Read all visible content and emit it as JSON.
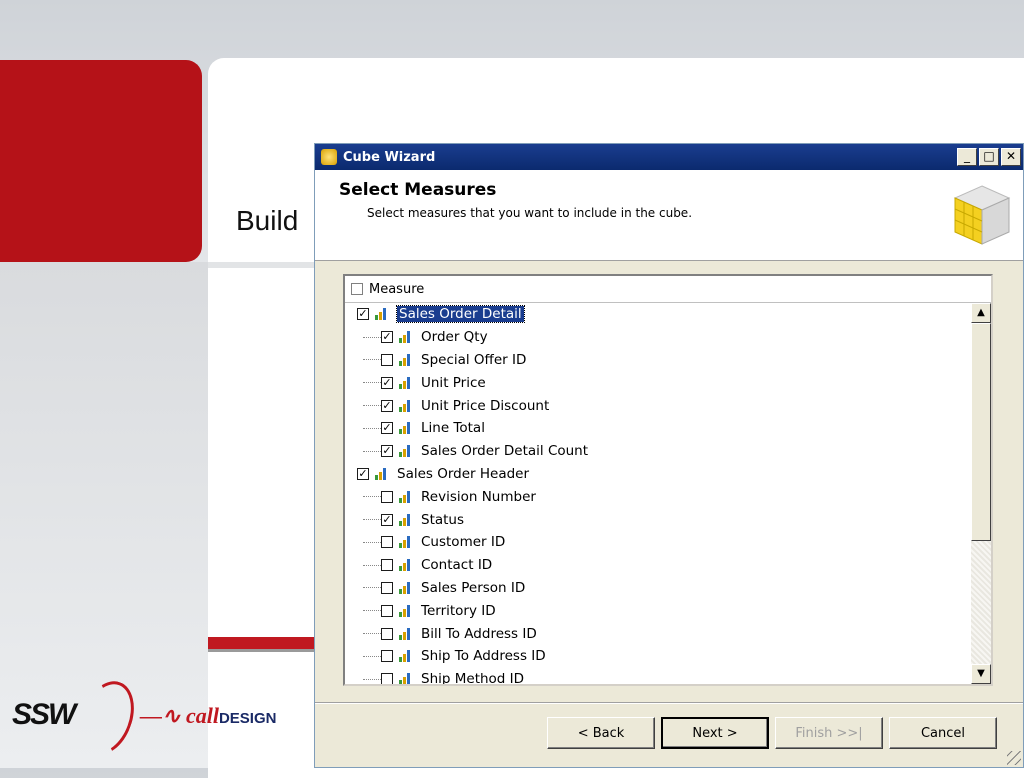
{
  "slide": {
    "title_fragment": "Build",
    "ssw_logo_text": "SSW",
    "call_logo_text": "call",
    "call_logo_design": "DESIGN"
  },
  "window": {
    "title": "Cube Wizard",
    "minimize_label": "_",
    "maximize_label": "□",
    "close_label": "✕"
  },
  "header": {
    "title": "Select Measures",
    "subtitle": "Select measures that you want to include in the cube."
  },
  "list": {
    "column_header": "Measure",
    "column_checked": false,
    "groups": [
      {
        "label": "Sales Order Detail",
        "checked": true,
        "selected": true,
        "items": [
          {
            "label": "Order Qty",
            "checked": true
          },
          {
            "label": "Special Offer ID",
            "checked": false
          },
          {
            "label": "Unit Price",
            "checked": true
          },
          {
            "label": "Unit Price Discount",
            "checked": true
          },
          {
            "label": "Line Total",
            "checked": true
          },
          {
            "label": "Sales Order Detail Count",
            "checked": true
          }
        ]
      },
      {
        "label": "Sales Order Header",
        "checked": true,
        "selected": false,
        "items": [
          {
            "label": "Revision Number",
            "checked": false
          },
          {
            "label": "Status",
            "checked": true
          },
          {
            "label": "Customer ID",
            "checked": false
          },
          {
            "label": "Contact ID",
            "checked": false
          },
          {
            "label": "Sales Person ID",
            "checked": false
          },
          {
            "label": "Territory ID",
            "checked": false
          },
          {
            "label": "Bill To Address ID",
            "checked": false
          },
          {
            "label": "Ship To Address ID",
            "checked": false
          },
          {
            "label": "Ship Method ID",
            "checked": false
          }
        ]
      }
    ]
  },
  "buttons": {
    "back": "< Back",
    "next": "Next >",
    "finish": "Finish >>|",
    "cancel": "Cancel"
  },
  "colors": {
    "title_bar": "#0b2a6e",
    "slide_red": "#b51218",
    "selection": "#1a3d8f"
  }
}
